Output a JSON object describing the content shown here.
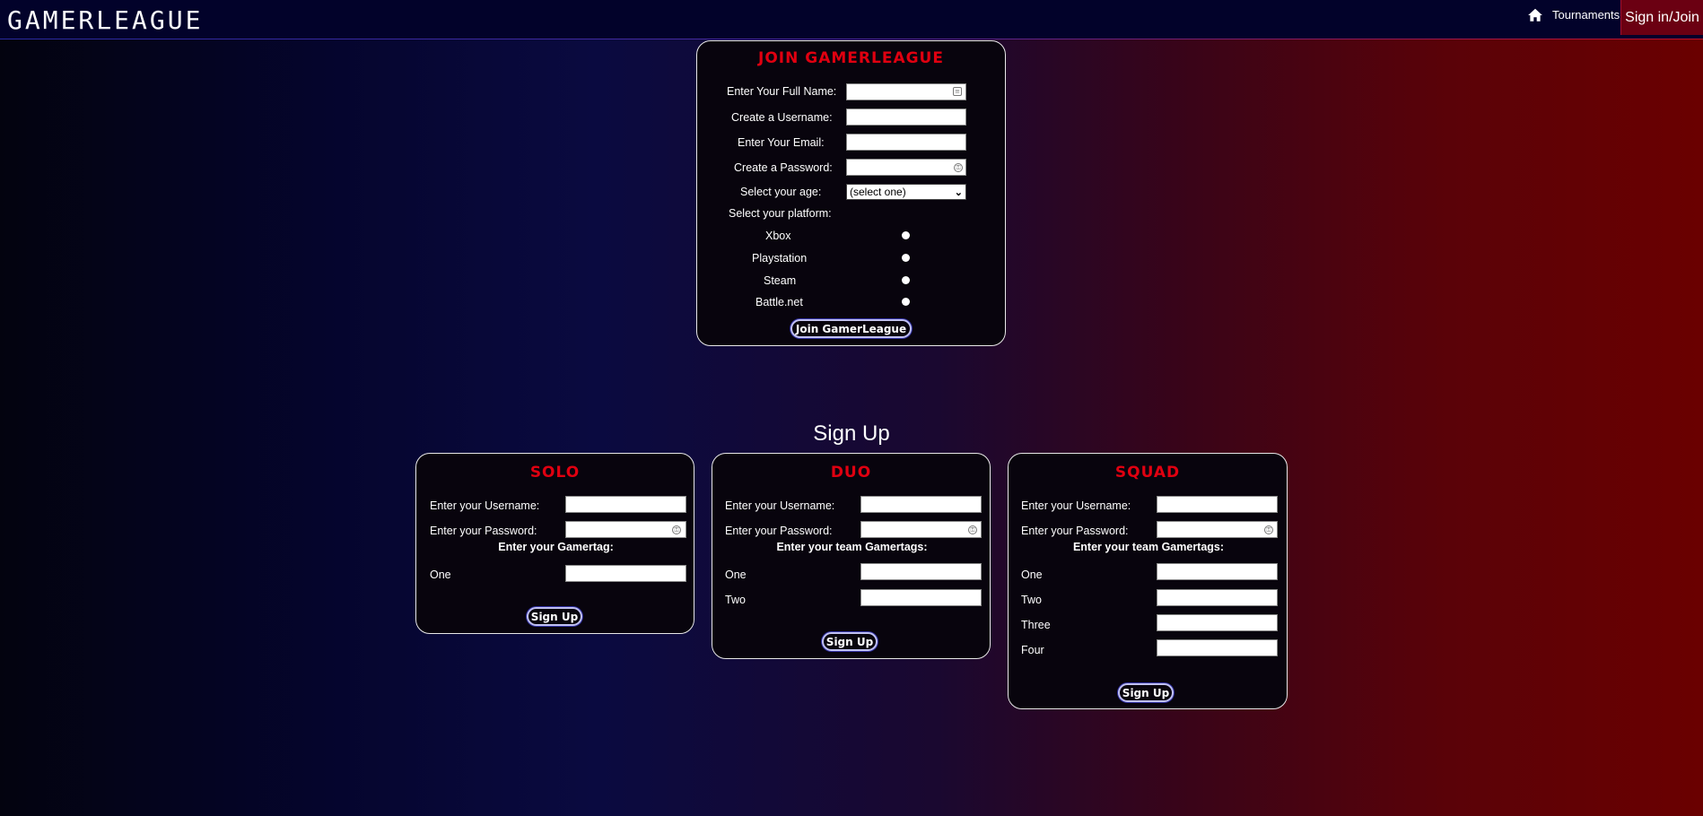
{
  "nav": {
    "logo": "GAMERLEAGUE",
    "home_icon": "home-icon",
    "tournaments": "Tournaments",
    "signin": "Sign in/Join"
  },
  "join": {
    "title": "JOIN GAMERLEAGUE",
    "full_name_label": "Enter Your Full Name:",
    "username_label": "Create a Username:",
    "email_label": "Enter Your Email:",
    "password_label": "Create a Password:",
    "age_label": "Select your age:",
    "age_selected": "(select one)",
    "platform_label": "Select your platform:",
    "platforms": [
      "Xbox",
      "Playstation",
      "Steam",
      "Battle.net"
    ],
    "button": "Join GamerLeague"
  },
  "signup": {
    "heading": "Sign Up",
    "solo": {
      "title": "SOLO",
      "username_label": "Enter your Username:",
      "password_label": "Enter your Password:",
      "gamertag_heading": "Enter your Gamertag:",
      "tags": [
        "One"
      ],
      "button": "Sign Up"
    },
    "duo": {
      "title": "DUO",
      "username_label": "Enter your Username:",
      "password_label": "Enter your Password:",
      "gamertag_heading": "Enter your team Gamertags:",
      "tags": [
        "One",
        "Two"
      ],
      "button": "Sign Up"
    },
    "squad": {
      "title": "SQUAD",
      "username_label": "Enter your Username:",
      "password_label": "Enter your Password:",
      "gamertag_heading": "Enter your team Gamertags:",
      "tags": [
        "One",
        "Two",
        "Three",
        "Four"
      ],
      "button": "Sign Up"
    }
  },
  "colors": {
    "title_red": "#e00010",
    "nav_bg": "#02022a",
    "signin_bg": "#6b0012"
  }
}
